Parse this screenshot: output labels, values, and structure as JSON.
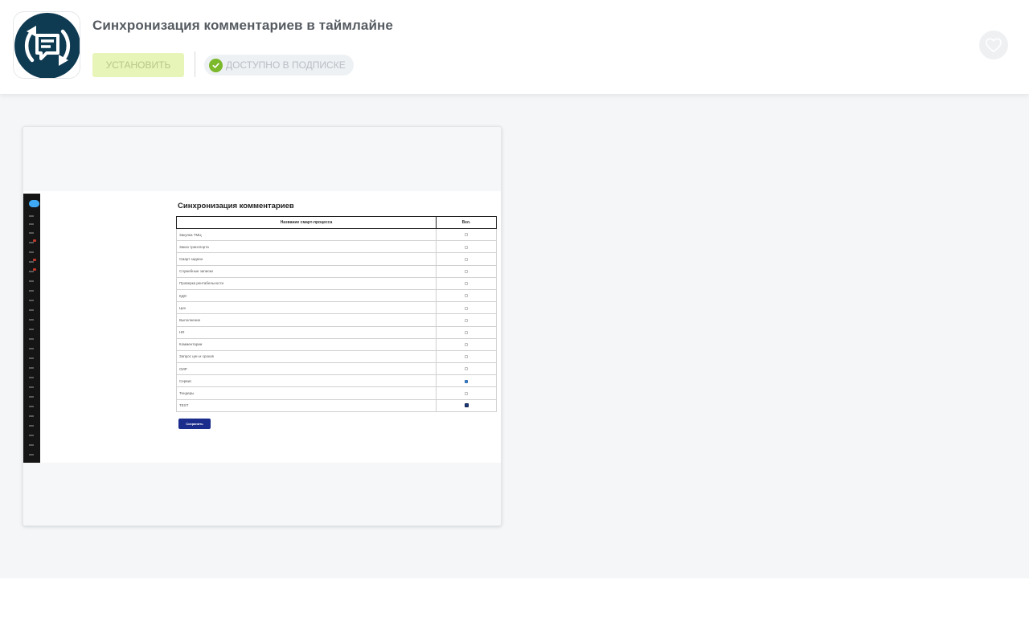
{
  "header": {
    "app_title": "Синхронизация комментариев в таймлайне",
    "install_label": "УСТАНОВИТЬ",
    "subscription_label": "ДОСТУПНО В ПОДПИСКЕ",
    "icons": {
      "app": "sync-comment-icon",
      "check": "check-circle-icon",
      "favorite": "heart-icon"
    }
  },
  "screenshot": {
    "title": "Синхронизация комментариев",
    "col_name": "Название смарт-процесса",
    "col_on": "Вкл.",
    "rows": [
      {
        "name": "Закупка ТМЦ",
        "state": "off"
      },
      {
        "name": "Заказ транспорта",
        "state": "off"
      },
      {
        "name": "Смарт задачи",
        "state": "off"
      },
      {
        "name": "Служебные записки",
        "state": "off"
      },
      {
        "name": "Проверка рентабельности",
        "state": "off"
      },
      {
        "name": "КДО",
        "state": "off"
      },
      {
        "name": "Цех",
        "state": "off"
      },
      {
        "name": "Выполнение",
        "state": "off"
      },
      {
        "name": "HR",
        "state": "off"
      },
      {
        "name": "Комментарии",
        "state": "off"
      },
      {
        "name": "Запрос цен и сроков",
        "state": "off"
      },
      {
        "name": "ОИР",
        "state": "off"
      },
      {
        "name": "Сервис",
        "state": "on"
      },
      {
        "name": "Тендеры",
        "state": "off"
      },
      {
        "name": "TEST",
        "state": "dark"
      }
    ],
    "save_label": "Сохранить"
  },
  "colors": {
    "brand_dark": "#0e3a52",
    "install_bg": "#e8f5b8",
    "check_green": "#7bb82a",
    "save_button": "#1b2d8c",
    "gallery_bg": "#f4f6f8"
  }
}
